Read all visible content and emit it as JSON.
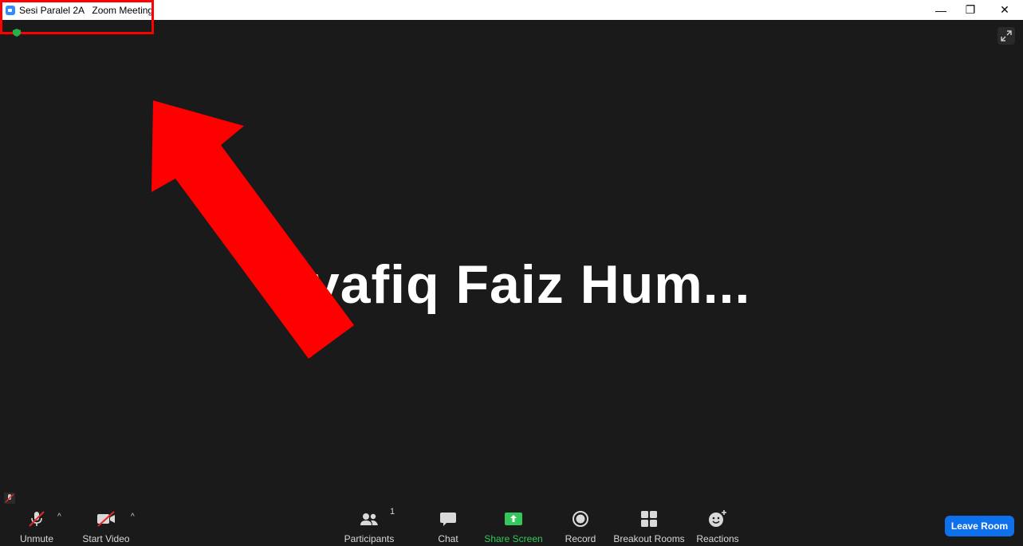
{
  "window": {
    "title": "Sesi Paralel 2A   Zoom Meeting",
    "minimize_glyph": "—",
    "restore_glyph": "❐",
    "close_glyph": "✕"
  },
  "meeting": {
    "participant_name": "Syafiq Faiz Hum..."
  },
  "toolbar": {
    "unmute_label": "Unmute",
    "start_video_label": "Start Video",
    "participants_label": "Participants",
    "participants_count": "1",
    "chat_label": "Chat",
    "share_screen_label": "Share Screen",
    "record_label": "Record",
    "breakout_rooms_label": "Breakout Rooms",
    "reactions_label": "Reactions",
    "caret_glyph": "^",
    "leave_room_label": "Leave Room"
  },
  "colors": {
    "accent_blue": "#0e71eb",
    "share_green": "#34c759",
    "annotation_red": "#ff0000",
    "background": "#1a1a1a"
  }
}
